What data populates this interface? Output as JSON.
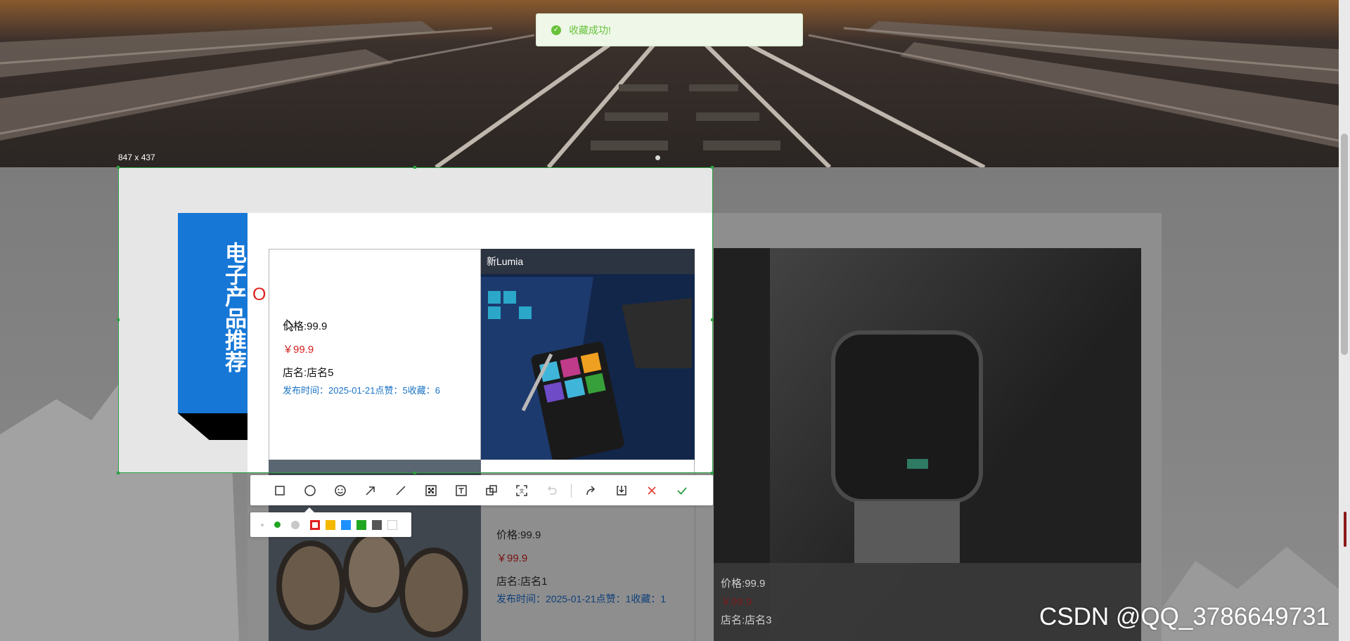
{
  "toast": {
    "icon": "check-circle-icon",
    "message": "收藏成功!"
  },
  "selection": {
    "size_label": "847 x 437",
    "accent_color": "#2ea043"
  },
  "category": {
    "title": "电子产品推荐",
    "color": "#1677d6"
  },
  "decor": {
    "red_o": "O"
  },
  "featured_product": {
    "caption": "新Lumia",
    "price_label": "价格:99.9",
    "price": "￥99.9",
    "shop": "店名:店名5",
    "meta": "发布时间：2025-01-21点赞：5收藏：6"
  },
  "product_lower": {
    "price_label": "价格:99.9",
    "price": "￥99.9",
    "shop": "店名:店名1",
    "meta": "发布时间：2025-01-21点赞：1收藏：1"
  },
  "product_right": {
    "price_label": "价格:99.9",
    "price": "￥99.9",
    "shop": "店名:店名3"
  },
  "toolbar": {
    "tools": [
      {
        "name": "rectangle-tool",
        "icon": "rectangle-icon"
      },
      {
        "name": "ellipse-tool",
        "icon": "circle-icon"
      },
      {
        "name": "emoji-tool",
        "icon": "smiley-icon"
      },
      {
        "name": "arrow-tool",
        "icon": "arrow-icon"
      },
      {
        "name": "line-tool",
        "icon": "line-icon"
      },
      {
        "name": "mosaic-tool",
        "icon": "mosaic-icon"
      },
      {
        "name": "text-tool",
        "icon": "text-icon"
      },
      {
        "name": "pin-tool",
        "icon": "pin-icon"
      },
      {
        "name": "ocr-tool",
        "icon": "ocr-icon"
      },
      {
        "name": "undo-tool",
        "icon": "undo-icon"
      },
      {
        "name": "share-tool",
        "icon": "share-icon"
      },
      {
        "name": "save-tool",
        "icon": "download-icon"
      },
      {
        "name": "cancel-tool",
        "icon": "close-icon"
      },
      {
        "name": "confirm-tool",
        "icon": "check-icon"
      }
    ]
  },
  "palette": {
    "sizes": [
      "small",
      "medium",
      "large"
    ],
    "selected_color": "#e02020",
    "colors": [
      "#e02020",
      "#f5b800",
      "#1e90ff",
      "#21a621",
      "#555555",
      "#ffffff"
    ]
  },
  "watermark": "CSDN @QQ_3786649731"
}
